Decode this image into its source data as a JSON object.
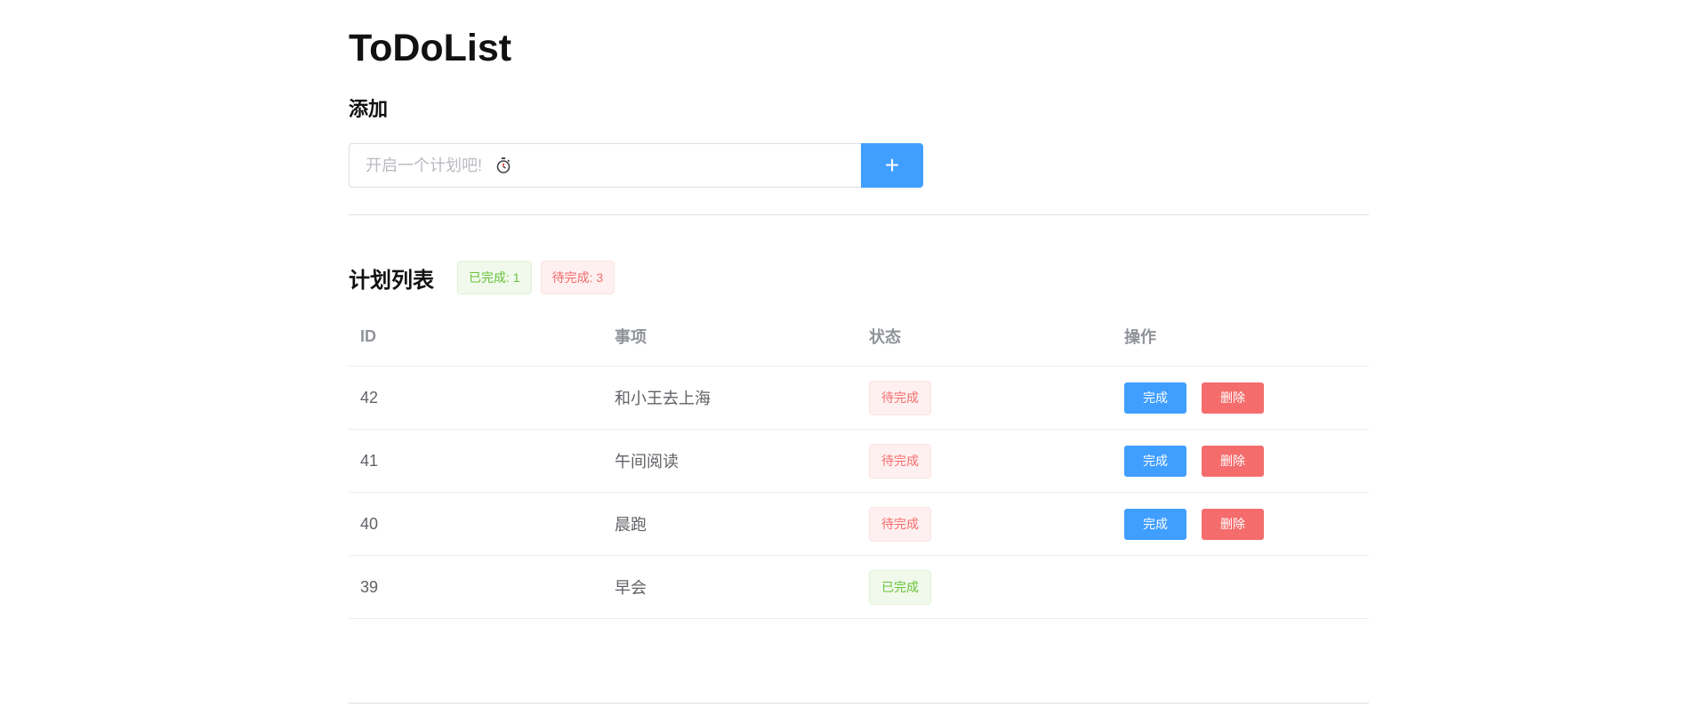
{
  "app": {
    "title": "ToDoList"
  },
  "add_section": {
    "heading": "添加",
    "input_placeholder": "开启一个计划吧!",
    "input_icon": "stopwatch-icon",
    "add_button_label": "+"
  },
  "list_section": {
    "heading": "计划列表",
    "completed_badge": "已完成: 1",
    "pending_badge": "待完成: 3"
  },
  "table": {
    "columns": [
      "ID",
      "事项",
      "状态",
      "操作"
    ],
    "rows": [
      {
        "id": "42",
        "item": "和小王去上海",
        "status": "待完成",
        "status_type": "pending",
        "complete_label": "完成",
        "delete_label": "删除"
      },
      {
        "id": "41",
        "item": "午间阅读",
        "status": "待完成",
        "status_type": "pending",
        "complete_label": "完成",
        "delete_label": "删除"
      },
      {
        "id": "40",
        "item": "晨跑",
        "status": "待完成",
        "status_type": "pending",
        "complete_label": "完成",
        "delete_label": "删除"
      },
      {
        "id": "39",
        "item": "早会",
        "status": "已完成",
        "status_type": "done",
        "complete_label": "",
        "delete_label": ""
      }
    ]
  },
  "colors": {
    "primary": "#409eff",
    "danger": "#f56c6c",
    "success": "#67c23a"
  }
}
